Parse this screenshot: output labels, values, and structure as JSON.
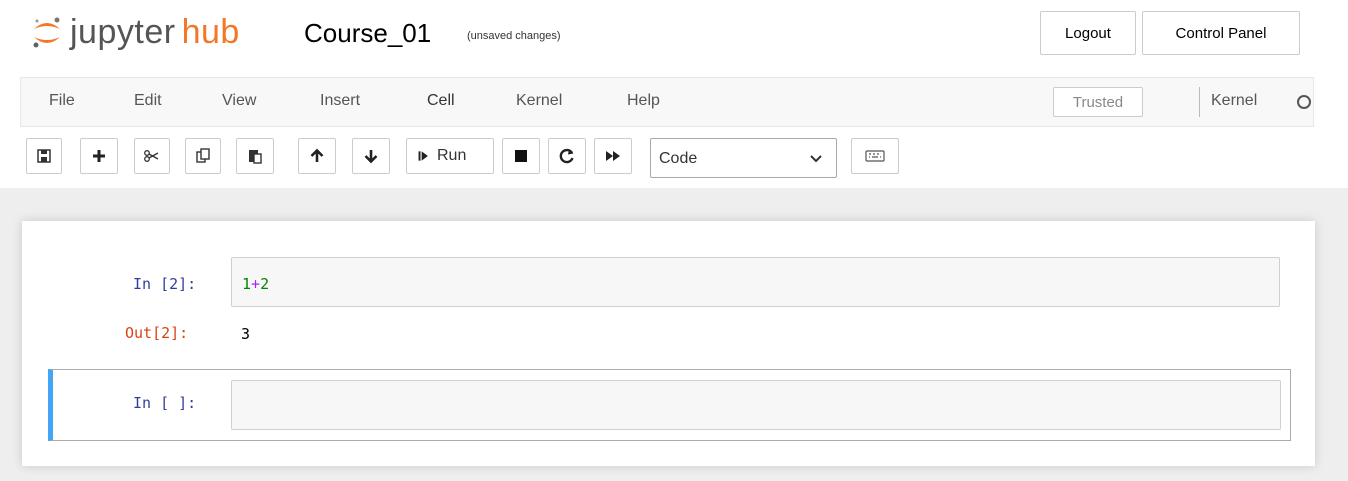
{
  "header": {
    "logo_text_1": "jupyter",
    "logo_text_2": "hub",
    "notebook_name": "Course_01",
    "checkpoint_status": "(unsaved changes)",
    "logout_label": "Logout",
    "control_panel_label": "Control Panel"
  },
  "menubar": {
    "items": [
      "File",
      "Edit",
      "View",
      "Insert",
      "Cell",
      "Kernel",
      "Help"
    ],
    "trusted_label": "Trusted",
    "kernel_name": "Kernel"
  },
  "toolbar": {
    "run_label": "Run",
    "cell_type": "Code",
    "icons": [
      "save-icon",
      "plus-icon",
      "scissors-icon",
      "copy-icon",
      "paste-icon",
      "arrow-up-icon",
      "arrow-down-icon",
      "run-icon",
      "stop-icon",
      "restart-icon",
      "fast-forward-icon",
      "keyboard-icon"
    ]
  },
  "cells": [
    {
      "in_prompt": "In [2]:",
      "code_num1": "1",
      "code_op": "+",
      "code_num2": "2",
      "out_prompt": "Out[2]:",
      "output": "3"
    },
    {
      "in_prompt": "In [ ]:",
      "code": ""
    }
  ],
  "colors": {
    "accent_orange": "#f37726",
    "in_prompt": "#303f9f",
    "out_prompt": "#d84315",
    "selected_cell": "#42a5f5",
    "number": "#008800",
    "operator": "#aa22ff"
  }
}
